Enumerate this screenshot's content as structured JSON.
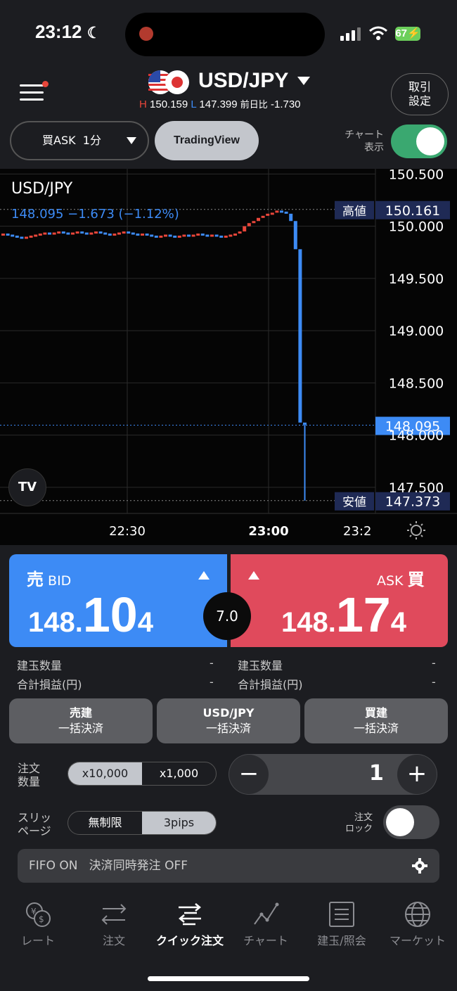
{
  "status_bar": {
    "time": "23:12",
    "battery": "67"
  },
  "header": {
    "pair": "USD/JPY",
    "high_prefix": "H",
    "high": "150.159",
    "low_prefix": "L",
    "low": "147.399",
    "change_label": "前日比",
    "change": "-1.730",
    "settings_line1": "取引",
    "settings_line2": "設定"
  },
  "toolbar": {
    "price_type": "買ASK",
    "interval": "1分",
    "tradingview_label": "TradingView",
    "chart_toggle_line1": "チャート",
    "chart_toggle_line2": "表示",
    "chart_toggle_on": true
  },
  "chart_data": {
    "type": "candlestick",
    "title": "USD/JPY",
    "last_label": "148.095 −1.673 (−1.12%)",
    "ylim": [
      147.25,
      150.55
    ],
    "y_ticks": [
      "150.500",
      "150.000",
      "149.500",
      "149.000",
      "148.500",
      "148.000",
      "147.500"
    ],
    "y_tick_values": [
      150.5,
      150.0,
      149.5,
      149.0,
      148.5,
      148.0,
      147.5
    ],
    "x_ticks": [
      "22:30",
      "23:00",
      "23:2"
    ],
    "high_marker_label": "高値",
    "high_marker_value": "150.161",
    "low_marker_label": "安値",
    "low_marker_value": "147.373",
    "current_price": "148.095",
    "current_price_value": 148.095,
    "high_value": 150.161,
    "low_value": 147.373,
    "candles_close": [
      149.93,
      149.92,
      149.91,
      149.9,
      149.89,
      149.9,
      149.91,
      149.92,
      149.93,
      149.94,
      149.93,
      149.94,
      149.95,
      149.94,
      149.93,
      149.94,
      149.95,
      149.94,
      149.93,
      149.94,
      149.95,
      149.94,
      149.93,
      149.92,
      149.93,
      149.94,
      149.95,
      149.94,
      149.93,
      149.92,
      149.93,
      149.92,
      149.91,
      149.9,
      149.91,
      149.92,
      149.91,
      149.9,
      149.91,
      149.92,
      149.91,
      149.92,
      149.93,
      149.92,
      149.91,
      149.92,
      149.91,
      149.9,
      149.91,
      149.92,
      149.93,
      149.95,
      150.0,
      150.03,
      150.05,
      150.08,
      150.1,
      150.12,
      150.13,
      150.15,
      150.14,
      150.12,
      150.05,
      149.78,
      148.12,
      148.1
    ]
  },
  "quote": {
    "bid_kanji": "売",
    "bid_label": "BID",
    "bid_small": "148.",
    "bid_big": "10",
    "bid_tail": "4",
    "ask_kanji": "買",
    "ask_label": "ASK",
    "ask_small": "148.",
    "ask_big": "17",
    "ask_tail": "4",
    "spread": "7.0"
  },
  "positions": {
    "qty_label": "建玉数量",
    "pl_label": "合計損益(円)",
    "sell_qty": "-",
    "sell_pl": "-",
    "buy_qty": "-",
    "buy_pl": "-"
  },
  "close_buttons": [
    {
      "line1": "売建",
      "line2": "一括決済"
    },
    {
      "line1": "USD/JPY",
      "line2": "一括決済"
    },
    {
      "line1": "買建",
      "line2": "一括決済"
    }
  ],
  "order": {
    "qty_label_1": "注文",
    "qty_label_2": "数量",
    "unit_options": [
      "x10,000",
      "x1,000"
    ],
    "unit_selected": "x10,000",
    "quantity": "1",
    "slip_label_1": "スリッ",
    "slip_label_2": "ページ",
    "slip_options": [
      "無制限",
      "3pips"
    ],
    "slip_selected": "3pips",
    "lock_label_1": "注文",
    "lock_label_2": "ロック",
    "lock_on": false
  },
  "fifo": {
    "text": "FIFO ON",
    "simultaneous": "決済同時発注 OFF"
  },
  "tabs": [
    {
      "label": "レート",
      "icon": "currency-exchange-icon"
    },
    {
      "label": "注文",
      "icon": "arrows-exchange-icon"
    },
    {
      "label": "クイック注文",
      "icon": "quick-order-icon",
      "active": true
    },
    {
      "label": "チャート",
      "icon": "chart-line-icon"
    },
    {
      "label": "建玉/照会",
      "icon": "list-document-icon"
    },
    {
      "label": "マーケット",
      "icon": "globe-icon"
    }
  ],
  "colors": {
    "bid": "#3d8bf5",
    "ask": "#e04a5c",
    "up_candle": "#e8463a",
    "down_candle": "#3d8bf5",
    "toggle_on": "#3aa870"
  }
}
